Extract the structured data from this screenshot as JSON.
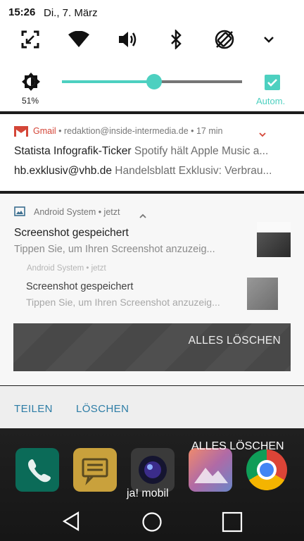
{
  "status": {
    "time": "15:26",
    "date": "Di., 7. März"
  },
  "quick_settings": {
    "icons": [
      "screen-capture-icon",
      "wifi-icon",
      "volume-icon",
      "bluetooth-icon",
      "auto-rotate-icon",
      "expand-chevron-icon"
    ],
    "brightness_percent": "51%",
    "brightness_level": 0.51,
    "auto_label": "Autom.",
    "auto_checked": true,
    "accent": "#4dd0c0"
  },
  "notifications": {
    "gmail": {
      "app": "Gmail",
      "header_rest": " • redaktion@inside-intermedia.de • 17 min",
      "line1_sender": "Statista Infografik-Ticker",
      "line1_subject": "Spotify hält Apple Music a...",
      "line2_sender": "hb.exklusiv@vhb.de",
      "line2_subject": "Handelsblatt Exklusiv: Verbrau..."
    },
    "android": {
      "header": "Android System • jetzt",
      "title": "Screenshot gespeichert",
      "text": "Tippen Sie, um Ihren Screenshot anzuzeig...",
      "ghost_header": "Android System • jetzt",
      "ghost_title": "Screenshot gespeichert",
      "ghost_text": "Tippen Sie, um Ihren Screenshot anzuzeig...",
      "clear_all": "ALLES LÖSCHEN"
    }
  },
  "actions": {
    "share": "TEILEN",
    "delete": "LÖSCHEN"
  },
  "home": {
    "clear_all": "ALLES LÖSCHEN",
    "app_label": "ja! mobil"
  }
}
